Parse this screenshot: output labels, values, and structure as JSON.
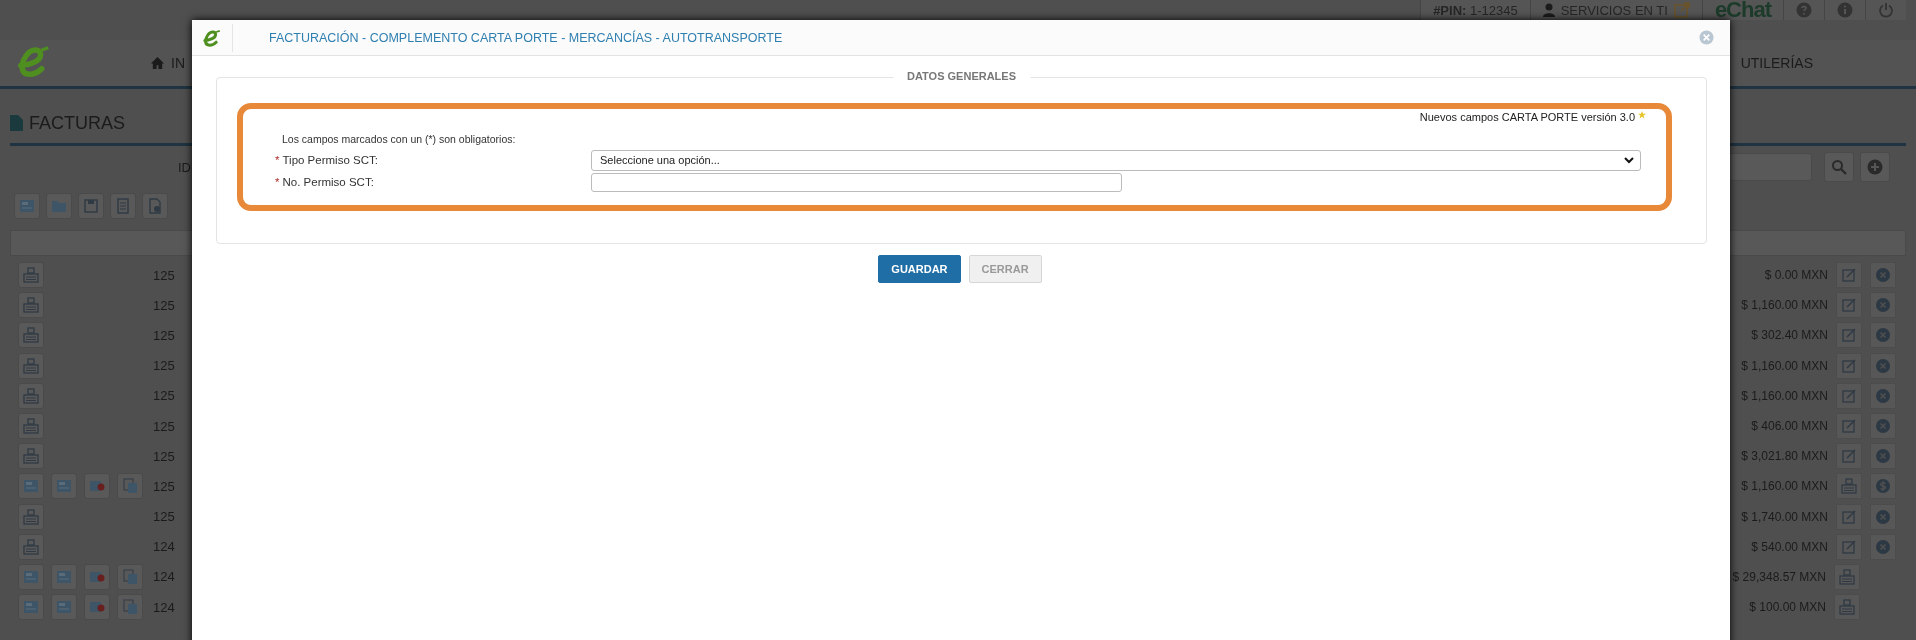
{
  "top_bar": {
    "pin_label": "#PIN:",
    "pin_value": "1-12345",
    "services": "SERVICIOS EN TI",
    "chat_logo": "eChat"
  },
  "nav": {
    "items": [
      {
        "label": "IN",
        "kind": "home"
      },
      {
        "label": "UTILERÍAS",
        "kind": "plain"
      }
    ]
  },
  "page": {
    "title": "FACTURAS",
    "filter_label": "ID"
  },
  "rows": [
    {
      "kind": "draft",
      "id": "125",
      "amount": "$ 0.00 MXN"
    },
    {
      "kind": "draft",
      "id": "125",
      "amount": "$ 1,160.00 MXN"
    },
    {
      "kind": "draft",
      "id": "125",
      "amount": "$ 302.40 MXN"
    },
    {
      "kind": "draft",
      "id": "125",
      "amount": "$ 1,160.00 MXN"
    },
    {
      "kind": "draft",
      "id": "125",
      "amount": "$ 1,160.00 MXN"
    },
    {
      "kind": "draft",
      "id": "125",
      "amount": "$ 406.00 MXN"
    },
    {
      "kind": "draft",
      "id": "125",
      "amount": "$ 3,021.80 MXN"
    },
    {
      "kind": "stamped",
      "id": "125",
      "amount": "$ 1,160.00 MXN",
      "payment_button": true
    },
    {
      "kind": "draft",
      "id": "125",
      "amount": "$ 1,740.00 MXN"
    },
    {
      "kind": "draft",
      "id": "124",
      "amount": "$ 540.00 MXN"
    },
    {
      "kind": "stamped",
      "id": "124",
      "amount": "$ 29,348.57 MXN",
      "payment_button": false
    },
    {
      "kind": "stamped",
      "id": "124",
      "amount": "$ 100.00 MXN",
      "payment_button": false
    }
  ],
  "modal": {
    "title": "FACTURACIÓN - COMPLEMENTO CARTA PORTE - MERCANCÍAS - AUTOTRANSPORTE",
    "section": {
      "legend": "DATOS GENERALES",
      "note": "Nuevos campos CARTA PORTE versión 3.0",
      "required_hint": "Los campos marcados con un (*) son obligatorios:",
      "fields": [
        {
          "kind": "select",
          "required_mark": "*",
          "label": "Tipo Permiso SCT:",
          "value": "Seleccione una opción..."
        },
        {
          "kind": "text",
          "required_mark": "*",
          "label": "No. Permiso SCT:"
        }
      ]
    },
    "buttons": [
      {
        "label": "GUARDAR",
        "disabled": false
      },
      {
        "label": "CERRAR",
        "disabled": true
      }
    ]
  }
}
